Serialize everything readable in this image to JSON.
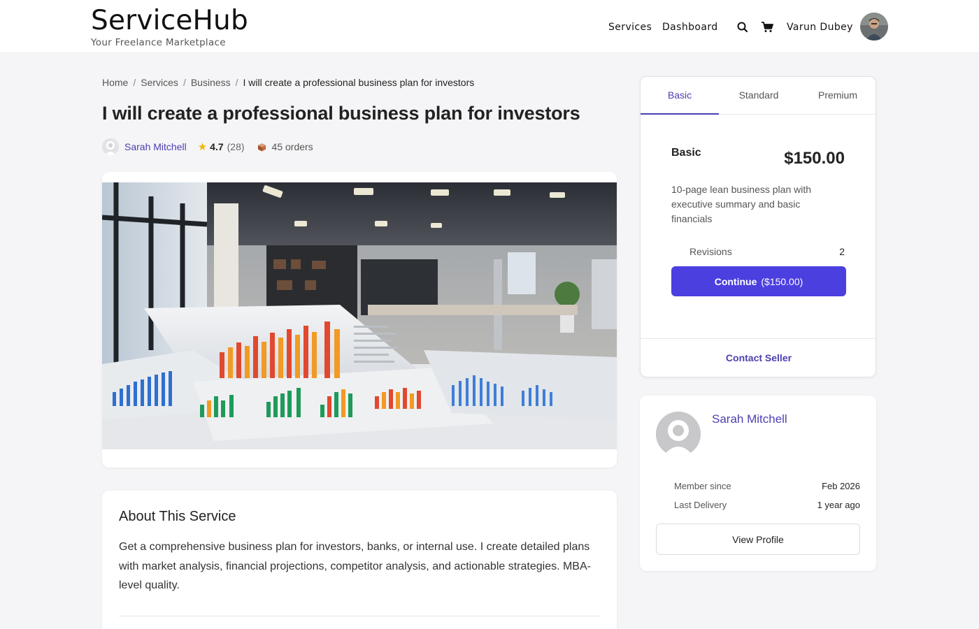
{
  "header": {
    "brand_name": "ServiceHub",
    "brand_tagline": "Your Freelance Marketplace",
    "nav": {
      "services": "Services",
      "dashboard": "Dashboard"
    },
    "user_name": "Varun Dubey"
  },
  "breadcrumb": {
    "items": [
      "Home",
      "Services",
      "Business"
    ],
    "current": "I will create a professional business plan for investors"
  },
  "service": {
    "title": "I will create a professional business plan for investors",
    "seller_name": "Sarah Mitchell",
    "rating": "4.7",
    "reviews": "(28)",
    "orders": "45 orders"
  },
  "about": {
    "title": "About This Service",
    "text": "Get a comprehensive business plan for investors, banks, or internal use. I create detailed plans with market analysis, financial projections, competitor analysis, and actionable strategies. MBA-level quality."
  },
  "package": {
    "tabs": [
      "Basic",
      "Standard",
      "Premium"
    ],
    "active_tab": "Basic",
    "name": "Basic",
    "price": "$150.00",
    "description": "10-page lean business plan with executive summary and basic financials",
    "revisions_label": "Revisions",
    "revisions_value": "2",
    "continue_label": "Continue",
    "continue_price": "($150.00)",
    "contact_label": "Contact Seller"
  },
  "seller_card": {
    "name": "Sarah Mitchell",
    "member_since_label": "Member since",
    "member_since_value": "Feb 2026",
    "last_delivery_label": "Last Delivery",
    "last_delivery_value": "1 year ago",
    "view_profile_label": "View Profile"
  },
  "colors": {
    "accent": "#4b3fe0",
    "link": "#4b3fb0",
    "star": "#f4b400"
  },
  "icons": [
    "search-icon",
    "cart-icon",
    "star-icon",
    "box-icon"
  ]
}
